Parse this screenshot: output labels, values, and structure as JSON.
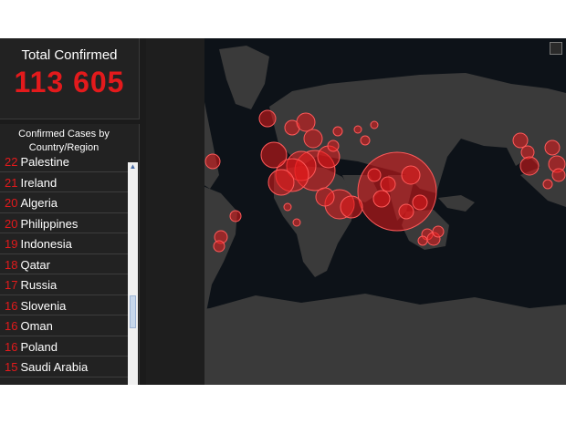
{
  "total": {
    "title": "Total Confirmed",
    "value": "113 605"
  },
  "list": {
    "header_line1": "Confirmed Cases by",
    "header_line2": "Country/Region",
    "rows": [
      {
        "count": "22",
        "name": "Palestine"
      },
      {
        "count": "21",
        "name": "Ireland"
      },
      {
        "count": "20",
        "name": "Algeria"
      },
      {
        "count": "20",
        "name": "Philippines"
      },
      {
        "count": "19",
        "name": "Indonesia"
      },
      {
        "count": "18",
        "name": "Qatar"
      },
      {
        "count": "17",
        "name": "Russia"
      },
      {
        "count": "16",
        "name": "Slovenia"
      },
      {
        "count": "16",
        "name": "Oman"
      },
      {
        "count": "16",
        "name": "Poland"
      },
      {
        "count": "15",
        "name": "Saudi Arabia"
      }
    ]
  },
  "colors": {
    "accent": "#e31a1c",
    "panel": "#222222",
    "map_ocean": "#0d1218",
    "map_land": "#3a3a3a"
  },
  "map": {
    "marker_icon": "red-circle"
  }
}
